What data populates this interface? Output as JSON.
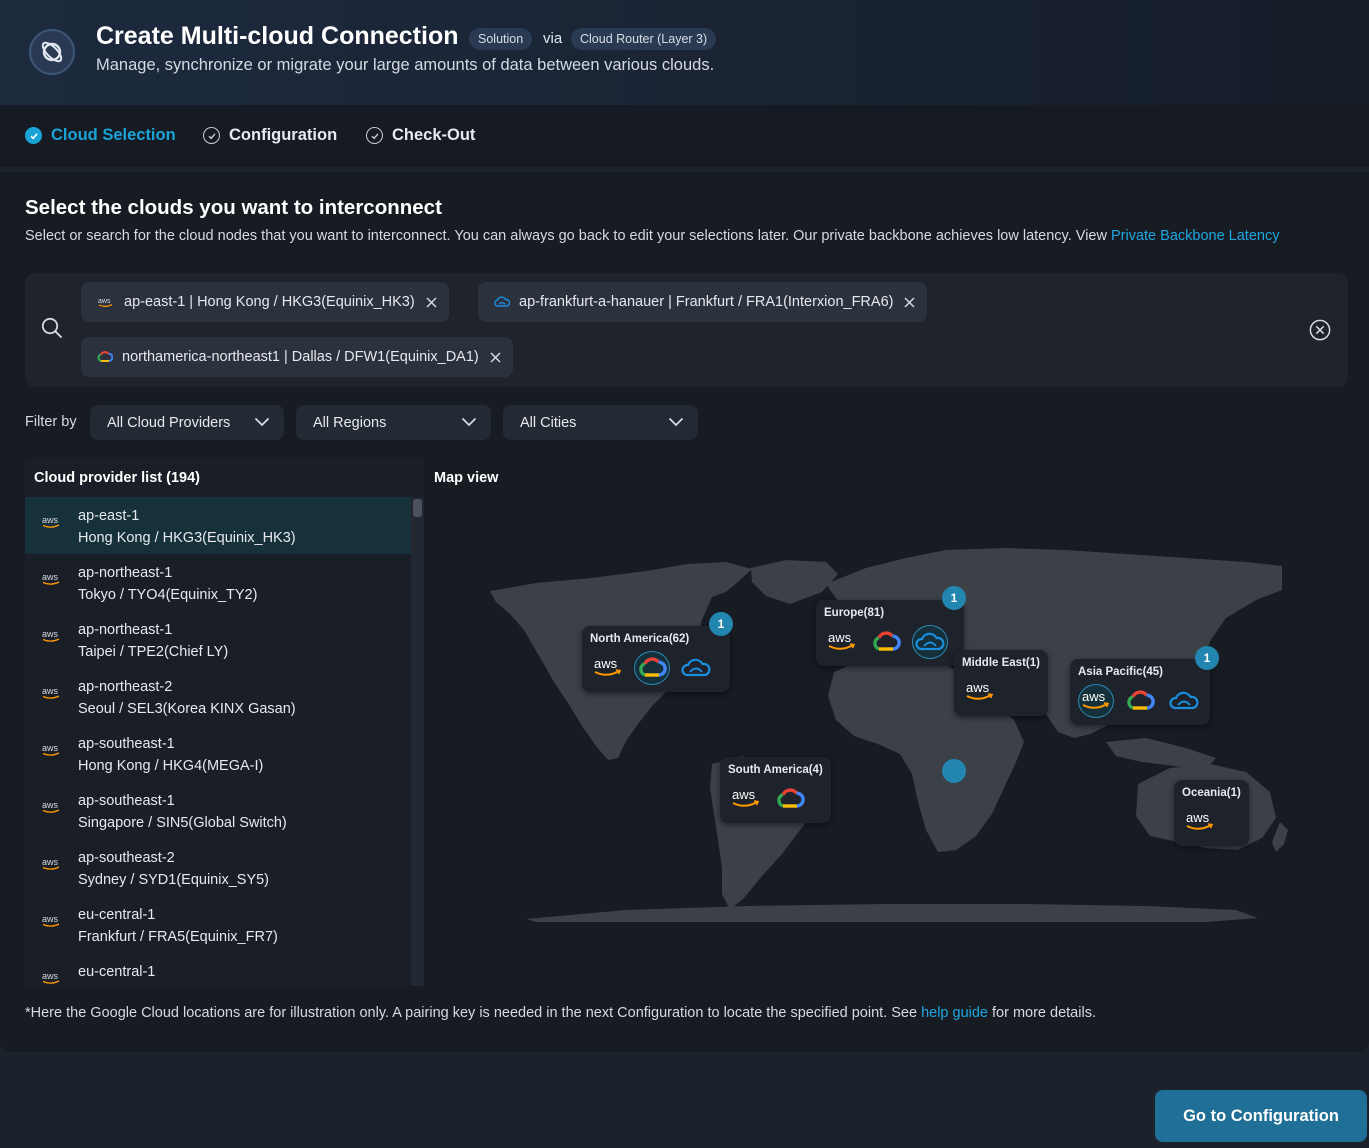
{
  "header": {
    "title": "Create Multi-cloud Connection",
    "badge_solution": "Solution",
    "via": "via",
    "badge_router": "Cloud Router (Layer 3)",
    "subtitle": "Manage, synchronize or migrate your large amounts of data between various clouds."
  },
  "steps": [
    {
      "label": "Cloud Selection",
      "state": "active"
    },
    {
      "label": "Configuration",
      "state": "pending"
    },
    {
      "label": "Check-Out",
      "state": "pending"
    }
  ],
  "section": {
    "title": "Select the clouds you want to interconnect",
    "description": "Select or search for the cloud nodes that you want to interconnect. You can always go back to edit your selections later. Our private backbone achieves low latency. View ",
    "link": "Private Backbone Latency"
  },
  "selected_chips": [
    {
      "provider": "aws",
      "label": "ap-east-1 | Hong Kong / HKG3(Equinix_HK3)"
    },
    {
      "provider": "alibaba",
      "label": "ap-frankfurt-a-hanauer | Frankfurt / FRA1(Interxion_FRA6)"
    },
    {
      "provider": "gcp",
      "label": "northamerica-northeast1 | Dallas / DFW1(Equinix_DA1)"
    }
  ],
  "filters": {
    "label": "Filter by",
    "providers": "All Cloud Providers",
    "regions": "All Regions",
    "cities": "All Cities"
  },
  "list": {
    "header": "Cloud provider list (194)",
    "items": [
      {
        "provider": "aws",
        "region": "ap-east-1",
        "location": "Hong Kong / HKG3(Equinix_HK3)",
        "selected": true
      },
      {
        "provider": "aws",
        "region": "ap-northeast-1",
        "location": "Tokyo / TYO4(Equinix_TY2)",
        "selected": false
      },
      {
        "provider": "aws",
        "region": "ap-northeast-1",
        "location": "Taipei / TPE2(Chief LY)",
        "selected": false
      },
      {
        "provider": "aws",
        "region": "ap-northeast-2",
        "location": "Seoul / SEL3(Korea KINX Gasan)",
        "selected": false
      },
      {
        "provider": "aws",
        "region": "ap-southeast-1",
        "location": "Hong Kong / HKG4(MEGA-I)",
        "selected": false
      },
      {
        "provider": "aws",
        "region": "ap-southeast-1",
        "location": "Singapore / SIN5(Global Switch)",
        "selected": false
      },
      {
        "provider": "aws",
        "region": "ap-southeast-2",
        "location": "Sydney / SYD1(Equinix_SY5)",
        "selected": false
      },
      {
        "provider": "aws",
        "region": "eu-central-1",
        "location": "Frankfurt / FRA5(Equinix_FR7)",
        "selected": false
      },
      {
        "provider": "aws",
        "region": "eu-central-1",
        "location": "",
        "selected": false
      }
    ]
  },
  "map": {
    "title": "Map view",
    "regions": [
      {
        "name": "North America(62)",
        "badge": "1",
        "providers": [
          "aws",
          "gcp",
          "alibaba"
        ],
        "selected": "gcp"
      },
      {
        "name": "Europe(81)",
        "badge": "1",
        "providers": [
          "aws",
          "gcp",
          "alibaba"
        ],
        "selected": "alibaba"
      },
      {
        "name": "Middle East(1)",
        "badge": "",
        "providers": [
          "aws"
        ],
        "selected": ""
      },
      {
        "name": "Asia Pacific(45)",
        "badge": "1",
        "providers": [
          "aws",
          "gcp",
          "alibaba"
        ],
        "selected": "aws"
      },
      {
        "name": "South America(4)",
        "badge": "",
        "providers": [
          "aws",
          "gcp"
        ],
        "selected": ""
      },
      {
        "name": "Oceania(1)",
        "badge": "",
        "providers": [
          "aws"
        ],
        "selected": ""
      }
    ]
  },
  "footnote": {
    "text_before": "*Here the Google Cloud locations are for illustration only. A pairing key is needed in the next Configuration to locate the specified point. See ",
    "link": "help guide",
    "text_after": " for more details."
  },
  "actions": {
    "next": "Go to Configuration"
  },
  "colors": {
    "accent": "#1aa3d6",
    "button": "#1f6f96",
    "aws_orange": "#ff9900",
    "alibaba_blue": "#1a8fe0"
  }
}
